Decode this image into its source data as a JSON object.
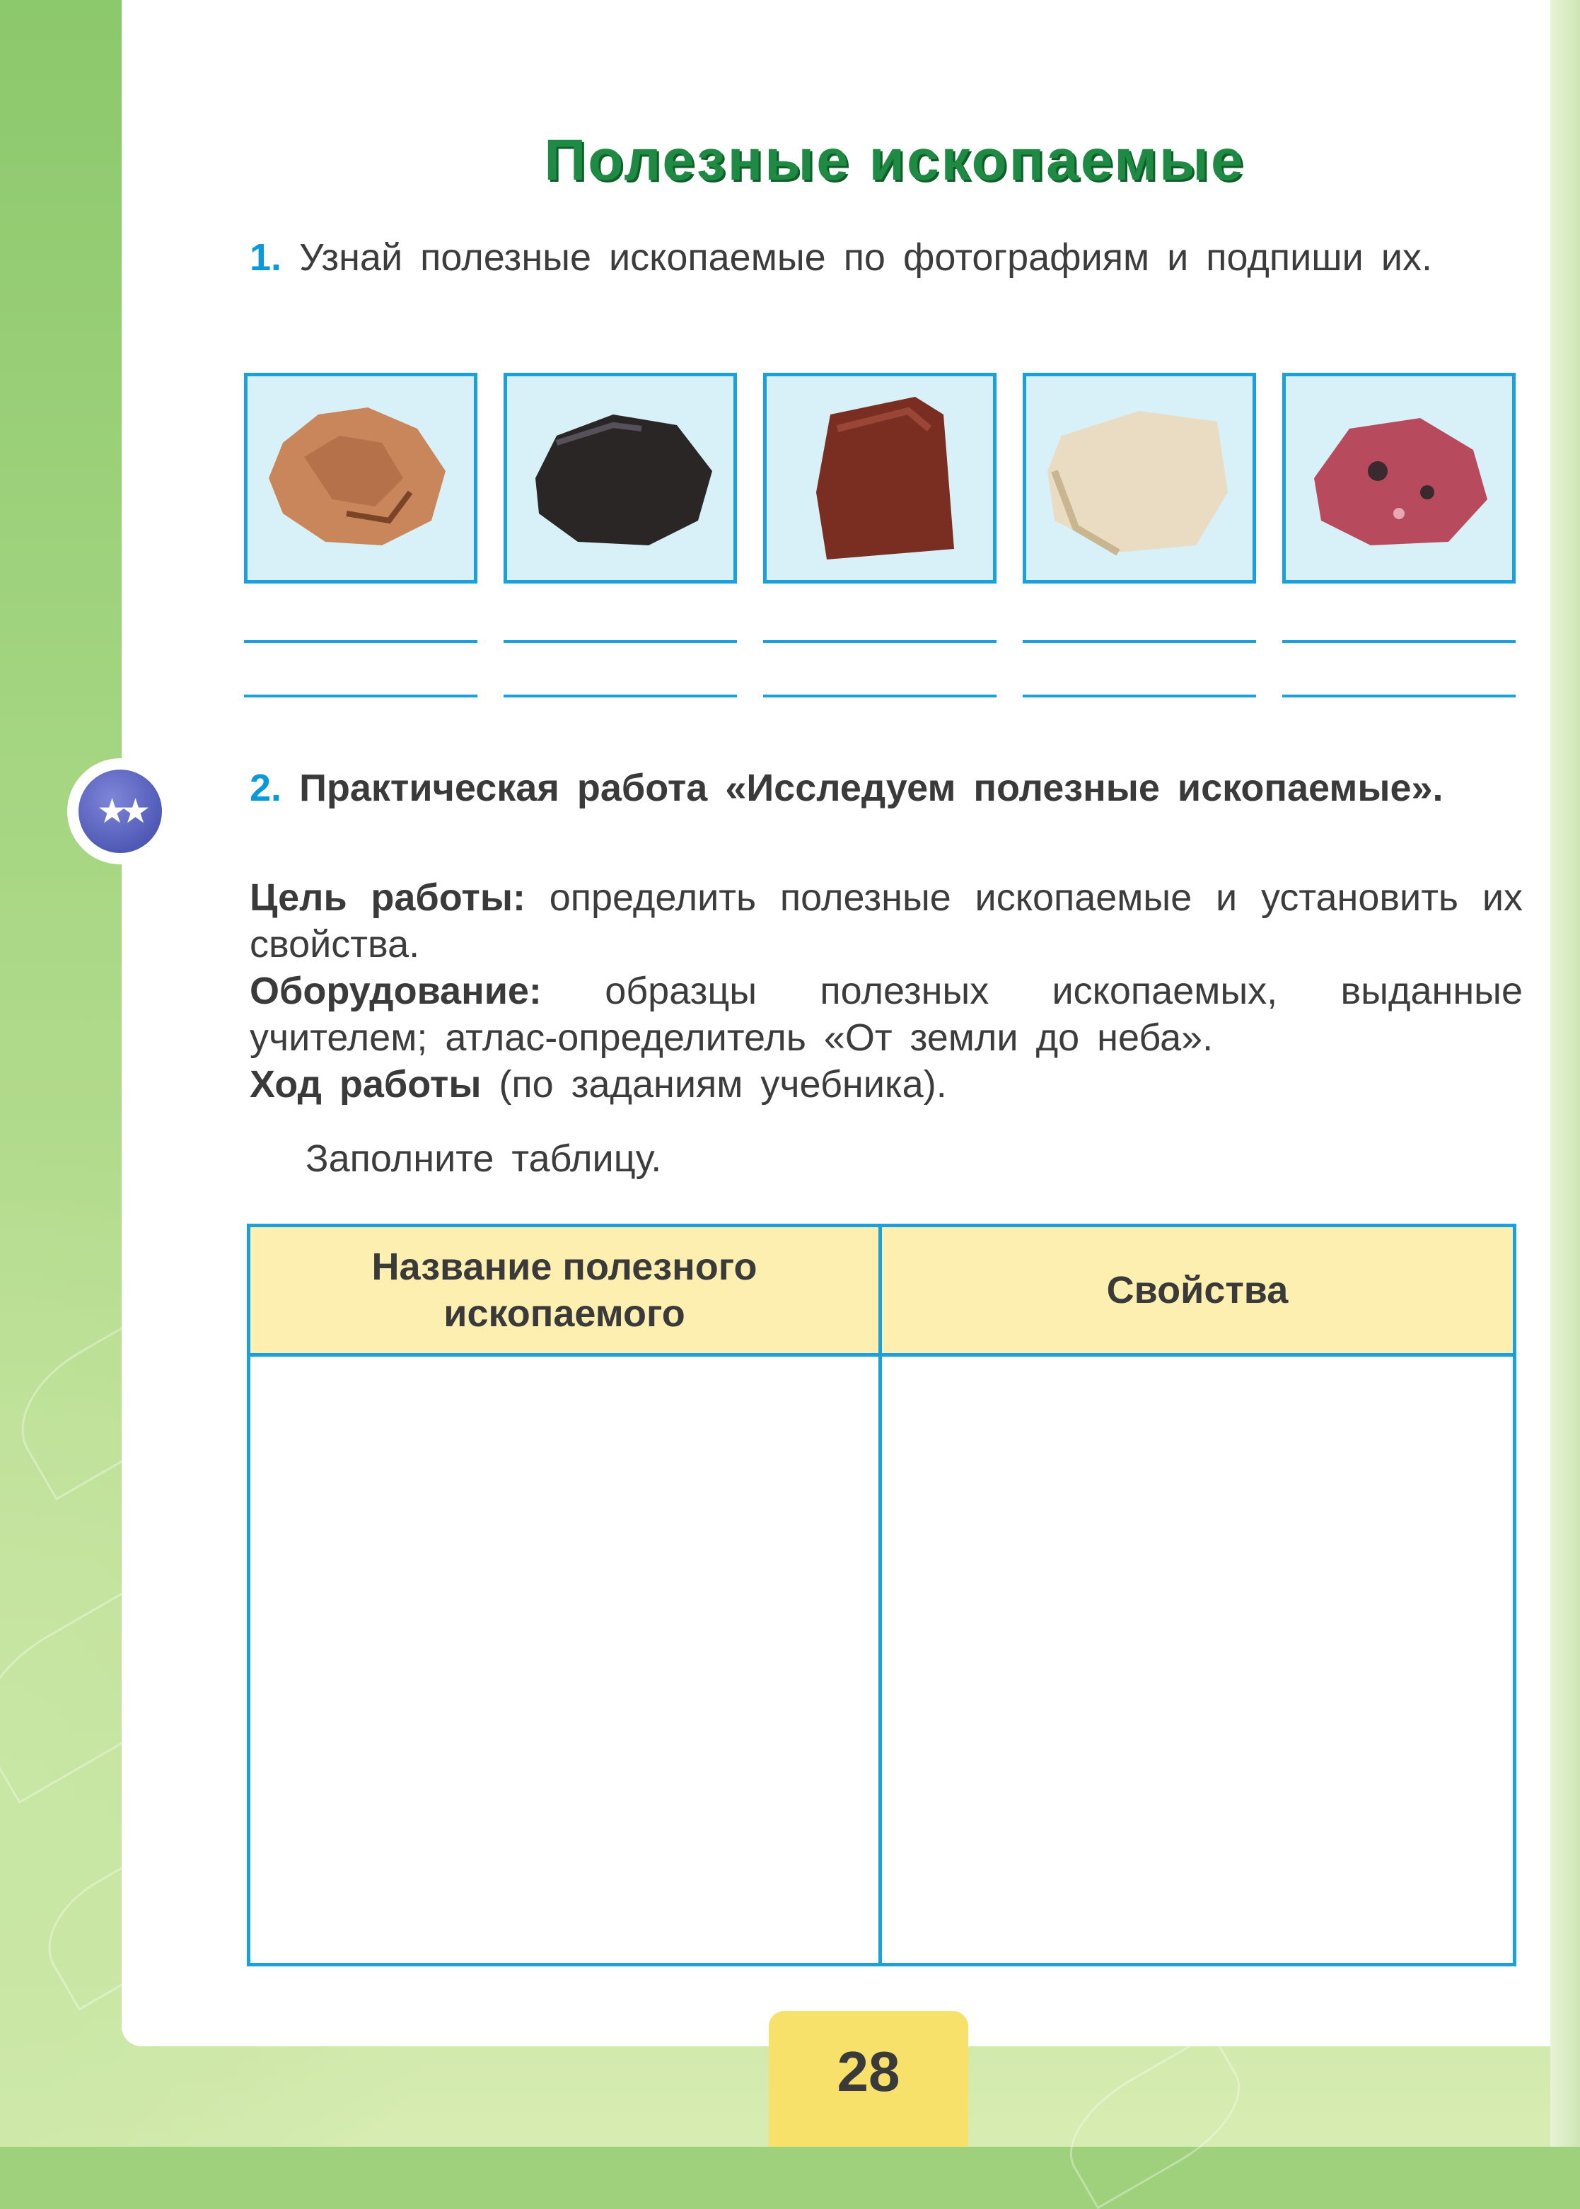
{
  "title": "Полезные ископаемые",
  "task1": {
    "number": "1.",
    "text": "Узнай полезные ископаемые по фотографиям и подпиши их."
  },
  "photos": [
    {
      "name": "rock-sample-1",
      "color": "#c9865a"
    },
    {
      "name": "rock-sample-2",
      "color": "#2b2626"
    },
    {
      "name": "rock-sample-3",
      "color": "#7a2e22"
    },
    {
      "name": "rock-sample-4",
      "color": "#e9dcc2"
    },
    {
      "name": "rock-sample-5",
      "color": "#b84a5d"
    }
  ],
  "task2": {
    "number": "2.",
    "heading": "Практическая работа «Исследуем полезные ископаемые».",
    "goal_label": "Цель работы:",
    "goal_text": "определить полезные ископаемые и установить их свойства.",
    "equipment_label": "Оборудование:",
    "equipment_text": "образцы полезных ископаемых, выданные учителем; атлас-определитель «От земли до неба».",
    "procedure_label": "Ход работы",
    "procedure_text": "(по заданиям учебника).",
    "instruction": "Заполните таблицу."
  },
  "table": {
    "columns": [
      "Название полезного ископаемого",
      "Свойства"
    ]
  },
  "page_number": "28",
  "colors": {
    "title": "#1e8a43",
    "accent_blue": "#1aa0dc",
    "header_fill": "#fcefb0",
    "page_tab": "#f7e16b"
  }
}
